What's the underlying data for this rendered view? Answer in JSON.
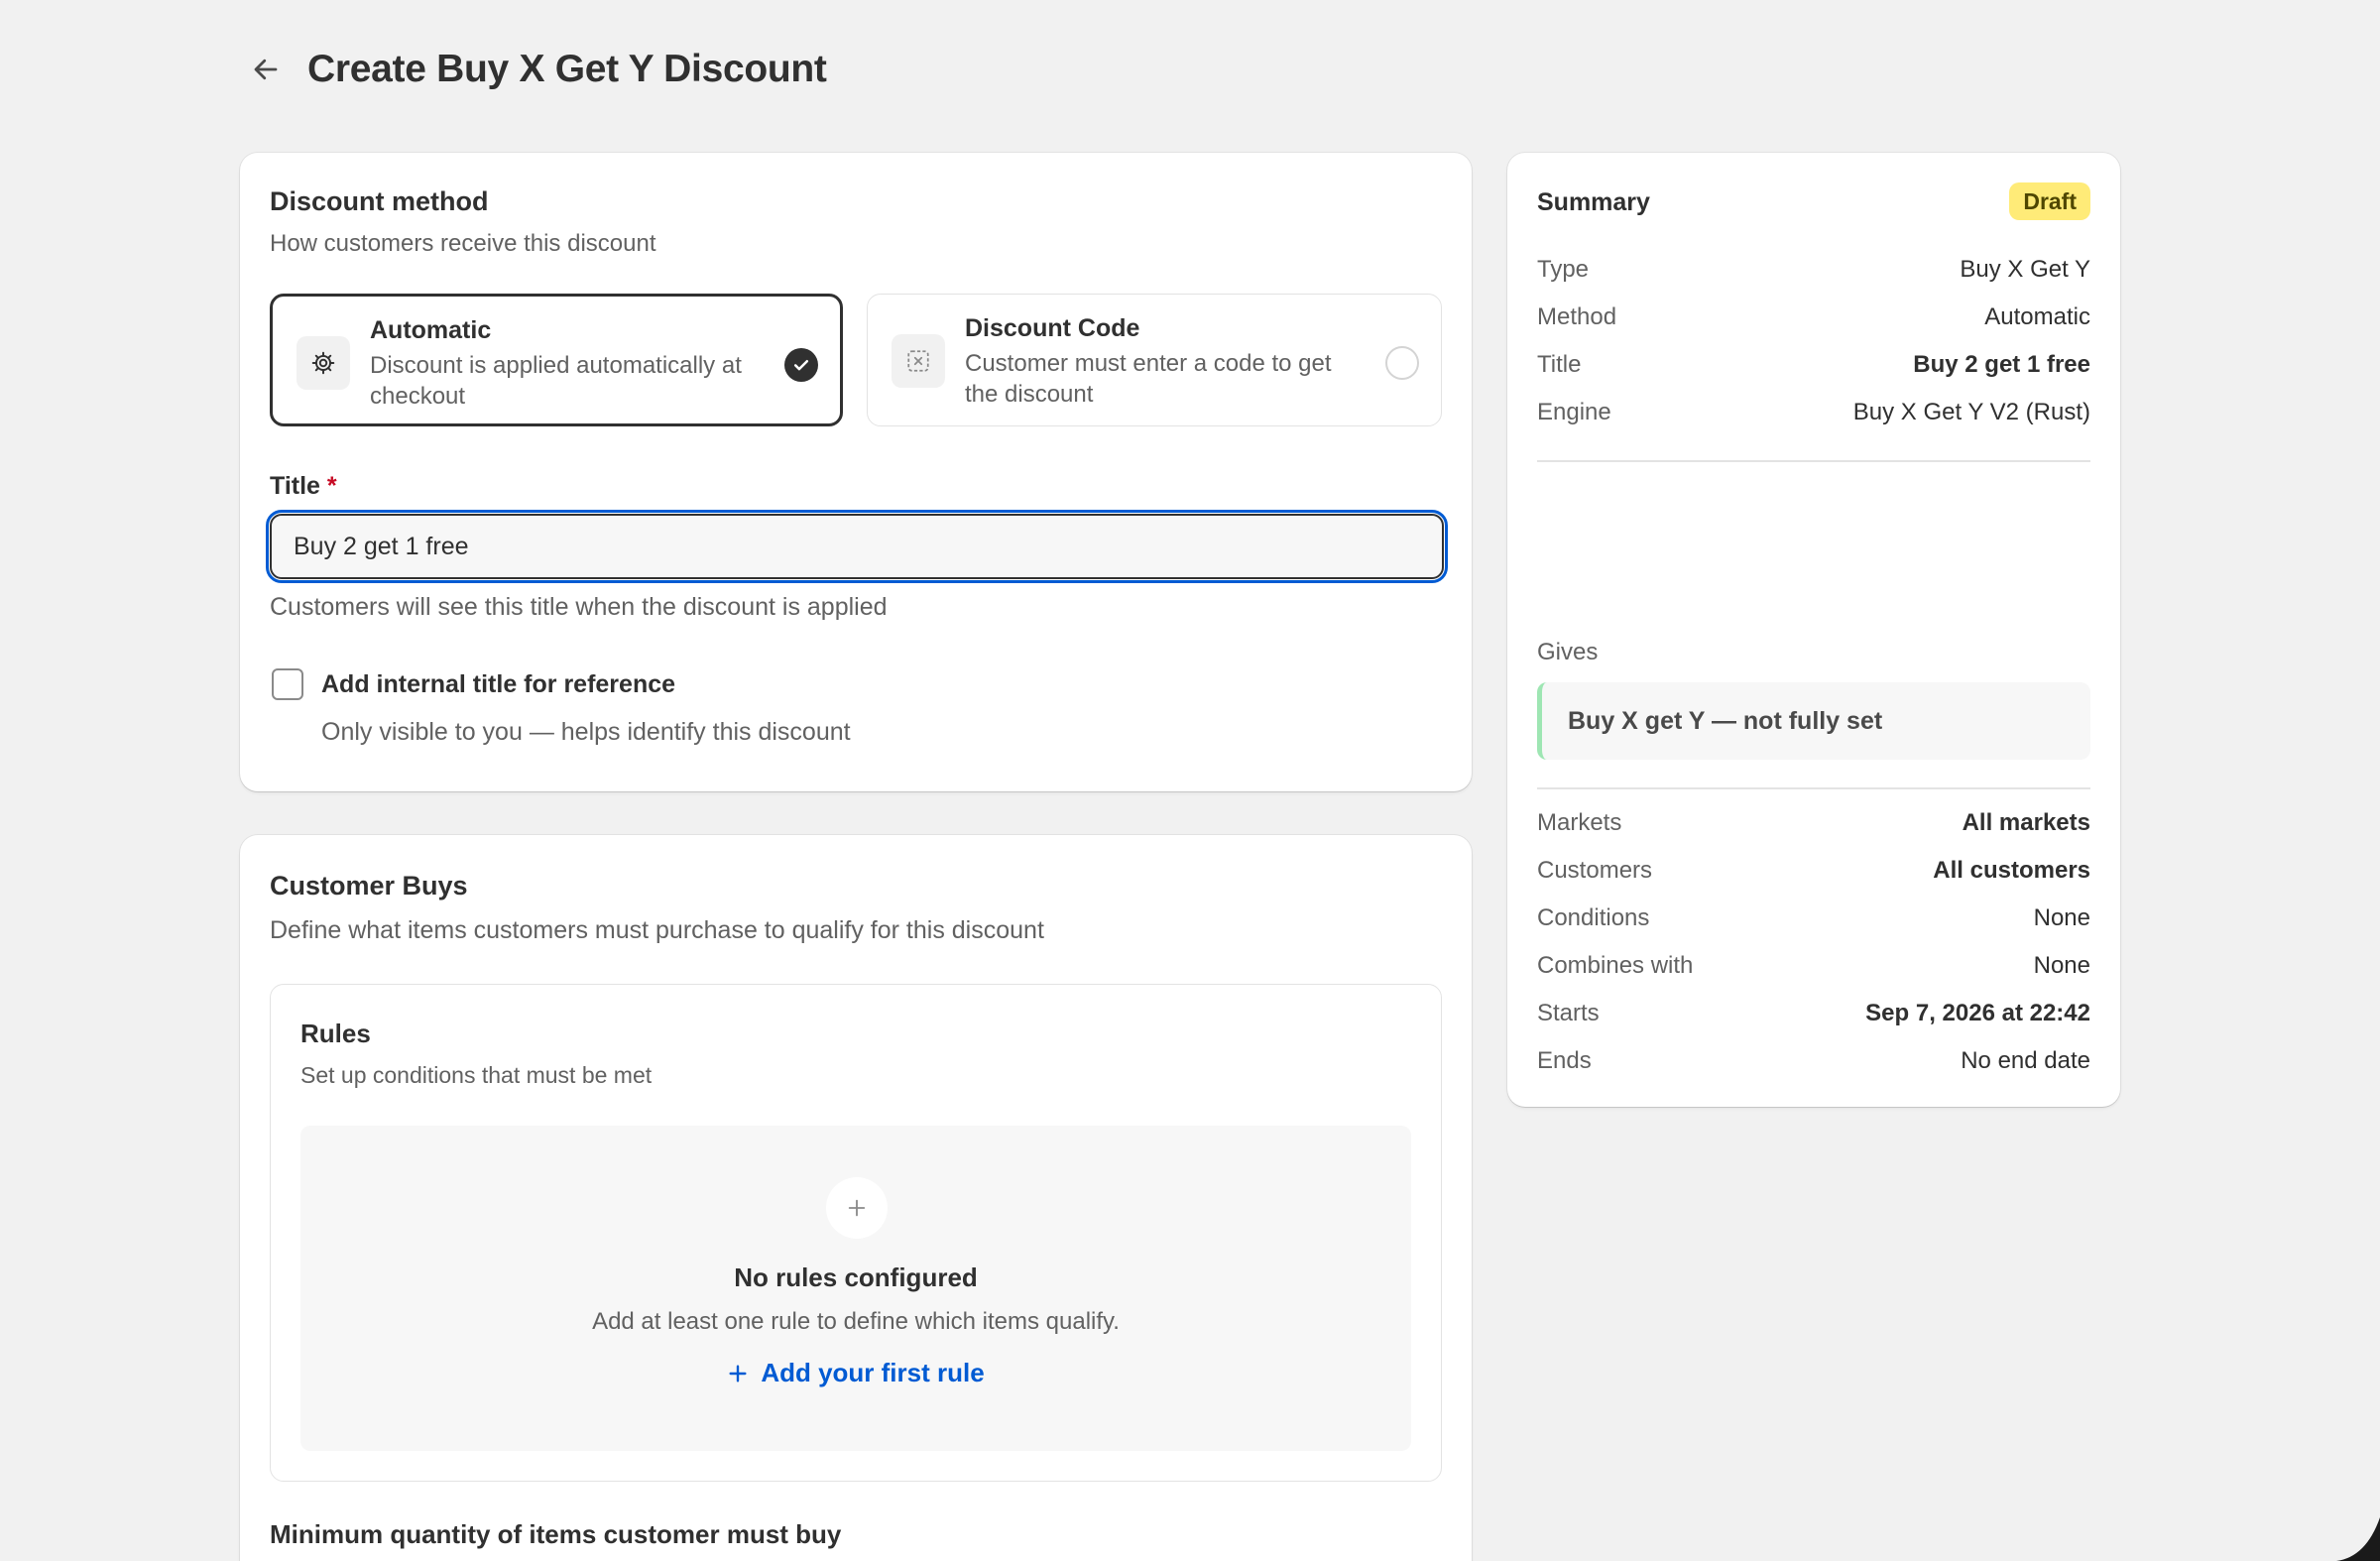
{
  "header": {
    "title": "Create Buy X Get Y Discount"
  },
  "method": {
    "title": "Discount method",
    "subtitle": "How customers receive this discount",
    "options": [
      {
        "title": "Automatic",
        "description": "Discount is applied automatically at checkout",
        "selected": true,
        "icon": "gear-icon"
      },
      {
        "title": "Discount Code",
        "description": "Customer must enter a code to get the discount",
        "selected": false,
        "icon": "code-icon"
      }
    ],
    "title_field": {
      "label": "Title",
      "required_mark": "*",
      "value": "Buy 2 get 1 free",
      "help": "Customers will see this title when the discount is applied"
    },
    "internal_title": {
      "label": "Add internal title for reference",
      "help": "Only visible to you — helps identify this discount",
      "checked": false
    }
  },
  "buys": {
    "title": "Customer Buys",
    "subtitle": "Define what items customers must purchase to qualify for this discount",
    "rules": {
      "title": "Rules",
      "subtitle": "Set up conditions that must be met",
      "empty_title": "No rules configured",
      "empty_desc": "Add at least one rule to define which items qualify.",
      "add_label": "Add your first rule"
    },
    "min_qty_label": "Minimum quantity of items customer must buy"
  },
  "summary": {
    "title": "Summary",
    "badge": "Draft",
    "badge_color": "#ffeb78",
    "rows_top": [
      {
        "key": "Type",
        "value": "Buy X Get Y"
      },
      {
        "key": "Method",
        "value": "Automatic"
      },
      {
        "key": "Title",
        "value": "Buy 2 get 1 free"
      },
      {
        "key": "Engine",
        "value": "Buy X Get Y V2 (Rust)"
      }
    ],
    "gives_label": "Gives",
    "gives_value": "Buy X get Y — not fully set",
    "rows_bottom": [
      {
        "key": "Markets",
        "value": "All markets"
      },
      {
        "key": "Customers",
        "value": "All customers"
      },
      {
        "key": "Conditions",
        "value": "None"
      },
      {
        "key": "Combines with",
        "value": "None"
      },
      {
        "key": "Starts",
        "value": "Sep 7, 2026 at 22:42"
      },
      {
        "key": "Ends",
        "value": "No end date"
      }
    ]
  },
  "colors": {
    "accent": "#005bd3",
    "primary_text": "#303030",
    "secondary_text": "#616161",
    "required": "#c70a24"
  }
}
